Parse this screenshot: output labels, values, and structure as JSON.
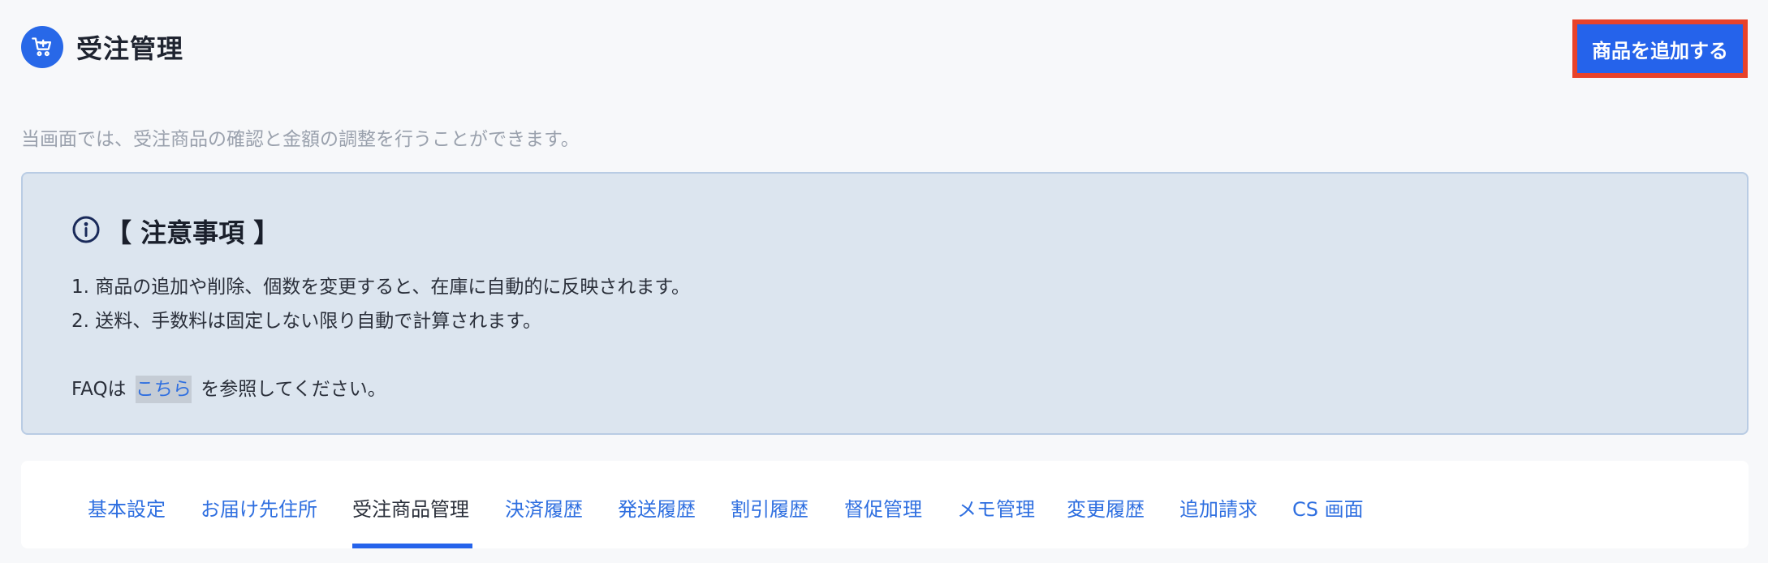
{
  "header": {
    "title": "受注管理",
    "icon": "cart-icon",
    "accent_color": "#2563eb"
  },
  "toolbar": {
    "add_product_label": "商品を追加する",
    "highlight_color": "#e8422a"
  },
  "description": "当画面では、受注商品の確認と金額の調整を行うことができます。",
  "notice": {
    "icon": "info-circle-icon",
    "title": "【 注意事項 】",
    "items": [
      "1. 商品の追加や削除、個数を変更すると、在庫に自動的に反映されます。",
      "2. 送料、手数料は固定しない限り自動で計算されます。"
    ],
    "faq_prefix": "FAQは",
    "faq_link": "こちら",
    "faq_suffix": "を参照してください。"
  },
  "tabs": [
    {
      "label": "基本設定",
      "active": false
    },
    {
      "label": "お届け先住所",
      "active": false
    },
    {
      "label": "受注商品管理",
      "active": true
    },
    {
      "label": "決済履歴",
      "active": false
    },
    {
      "label": "発送履歴",
      "active": false
    },
    {
      "label": "割引履歴",
      "active": false
    },
    {
      "label": "督促管理",
      "active": false
    },
    {
      "label": "メモ管理",
      "active": false
    },
    {
      "label": "変更履歴",
      "active": false
    },
    {
      "label": "追加請求",
      "active": false
    },
    {
      "label": "CS 画面",
      "active": false
    }
  ]
}
